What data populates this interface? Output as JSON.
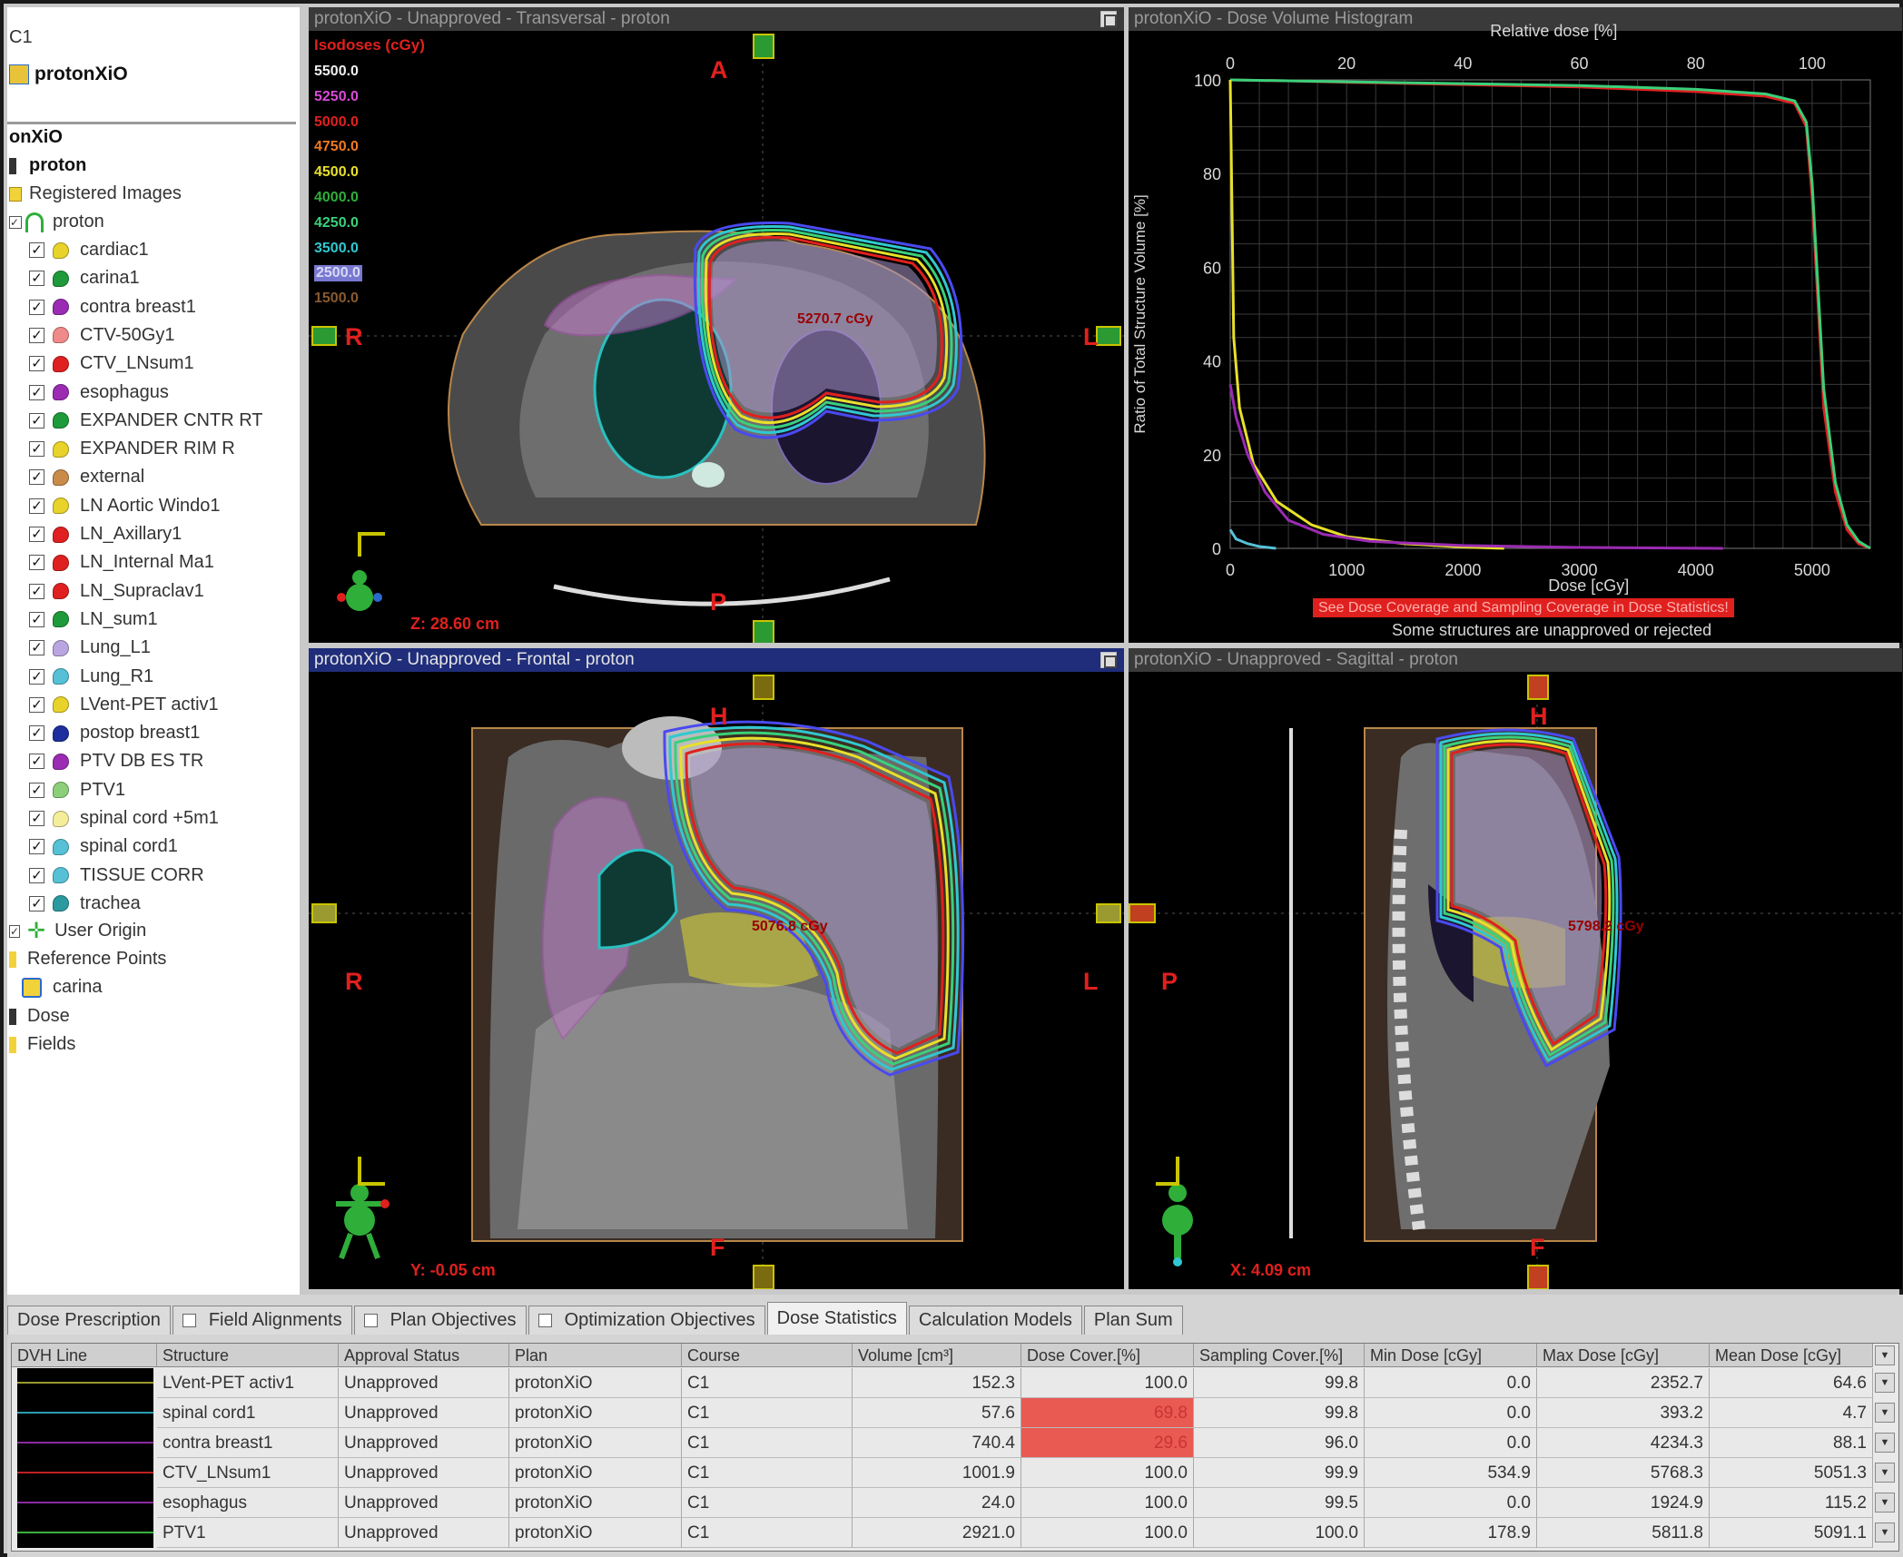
{
  "sidebar": {
    "top_code": "C1",
    "top_item": "protonXiO",
    "header": "onXiO",
    "plan": "proton",
    "registered_images": "Registered Images",
    "image_set": "proton",
    "structures": [
      {
        "name": "cardiac1",
        "color": "#e8d32a"
      },
      {
        "name": "carina1",
        "color": "#1f9a3a"
      },
      {
        "name": "contra breast1",
        "color": "#9b2bb3"
      },
      {
        "name": "CTV-50Gy1",
        "color": "#f08a8a"
      },
      {
        "name": "CTV_LNsum1",
        "color": "#e02020"
      },
      {
        "name": "esophagus",
        "color": "#9b2bb3"
      },
      {
        "name": "EXPANDER CNTR RT",
        "color": "#1f9a3a"
      },
      {
        "name": "EXPANDER RIM R",
        "color": "#e8d32a"
      },
      {
        "name": "external",
        "color": "#c98b4a"
      },
      {
        "name": "LN Aortic Windo1",
        "color": "#e8d32a"
      },
      {
        "name": "LN_Axillary1",
        "color": "#e02020"
      },
      {
        "name": "LN_Internal Ma1",
        "color": "#e02020"
      },
      {
        "name": "LN_Supraclav1",
        "color": "#e02020"
      },
      {
        "name": "LN_sum1",
        "color": "#1f9a3a"
      },
      {
        "name": "Lung_L1",
        "color": "#b9a6e0"
      },
      {
        "name": "Lung_R1",
        "color": "#56c1d6"
      },
      {
        "name": "LVent-PET activ1",
        "color": "#e8d32a"
      },
      {
        "name": "postop breast1",
        "color": "#1d2f9e"
      },
      {
        "name": "PTV DB ES TR",
        "color": "#9b2bb3"
      },
      {
        "name": "PTV1",
        "color": "#8ccf7a"
      },
      {
        "name": "spinal cord +5m1",
        "color": "#f4ed9a"
      },
      {
        "name": "spinal cord1",
        "color": "#56c1d6"
      },
      {
        "name": "TISSUE CORR",
        "color": "#56c1d6"
      },
      {
        "name": "trachea",
        "color": "#2a9aa0"
      }
    ],
    "user_origin": "User Origin",
    "reference_points": "Reference Points",
    "carina": "carina",
    "dose": "Dose",
    "fields": "Fields"
  },
  "views": {
    "transversal": {
      "title": "protonXiO - Unapproved - Transversal - proton",
      "top": "A",
      "bottom": "P",
      "left": "R",
      "right": "L",
      "position": "Z: 28.60 cm",
      "dose_label": "5270.7 cGy"
    },
    "frontal": {
      "title": "protonXiO - Unapproved - Frontal - proton",
      "top": "H",
      "bottom": "F",
      "left": "R",
      "right": "L",
      "position": "Y: -0.05 cm",
      "dose_label": "5076.8 cGy"
    },
    "sagittal": {
      "title": "protonXiO - Unapproved - Sagittal - proton",
      "top": "H",
      "bottom": "F",
      "left": "P",
      "position": "X: 4.09 cm",
      "dose_label": "5798.2 cGy"
    }
  },
  "isodoses": {
    "title": "Isodoses (cGy)",
    "levels": [
      {
        "value": "5500.0",
        "color": "#f0f0f0"
      },
      {
        "value": "5250.0",
        "color": "#d84bd8"
      },
      {
        "value": "5000.0",
        "color": "#e0201e"
      },
      {
        "value": "4750.0",
        "color": "#f07a20"
      },
      {
        "value": "4500.0",
        "color": "#e8e02a"
      },
      {
        "value": "4000.0",
        "color": "#2fae3a"
      },
      {
        "value": "4250.0",
        "color": "#3ad07a"
      },
      {
        "value": "3500.0",
        "color": "#30c8d0"
      },
      {
        "value": "2500.0",
        "color": "#d8d8f8"
      },
      {
        "value": "1500.0",
        "color": "#8a5a30"
      }
    ]
  },
  "dvh": {
    "title": "protonXiO - Dose Volume Histogram",
    "warning": "See Dose Coverage and Sampling Coverage in Dose Statistics!",
    "note": "Some structures are unapproved or rejected"
  },
  "chart_data": {
    "type": "line",
    "title": "",
    "xlabel": "Dose [cGy]",
    "x2label": "Relative dose [%]",
    "ylabel": "Ratio of Total Structure Volume [%]",
    "xlim": [
      0,
      5500
    ],
    "ylim": [
      0,
      100
    ],
    "x_ticks": [
      "1000",
      "2000",
      "3000",
      "4000",
      "5000"
    ],
    "x_tick_zero": "0",
    "x2_ticks": [
      "0",
      "20",
      "40",
      "60",
      "80",
      "100"
    ],
    "y_ticks": [
      "0",
      "20",
      "40",
      "60",
      "80",
      "100"
    ],
    "grid": true,
    "series": [
      {
        "color": "#e02020",
        "x": [
          0,
          500,
          1000,
          2000,
          3000,
          4000,
          4600,
          4850,
          4950,
          5000,
          5100,
          5200,
          5300,
          5400,
          5500
        ],
        "y": [
          100,
          99.8,
          99.5,
          99,
          98.5,
          97.5,
          96.5,
          95,
          90,
          75,
          30,
          12,
          4,
          1,
          0
        ]
      },
      {
        "color": "#3ad07a",
        "x": [
          0,
          500,
          1000,
          2000,
          3000,
          4000,
          4600,
          4850,
          4950,
          5000,
          5100,
          5200,
          5300,
          5400,
          5500
        ],
        "y": [
          100,
          99.8,
          99.6,
          99.2,
          98.8,
          98,
          97,
          95.5,
          91,
          78,
          34,
          14,
          5,
          1.5,
          0
        ]
      },
      {
        "color": "#e8e02a",
        "x": [
          0,
          30,
          80,
          200,
          400,
          700,
          1000,
          1500,
          2000,
          2353
        ],
        "y": [
          100,
          45,
          30,
          18,
          10,
          5,
          2.5,
          1,
          0.3,
          0
        ]
      },
      {
        "color": "#9b2bb3",
        "x": [
          0,
          50,
          150,
          300,
          500,
          800,
          1200,
          2000,
          3000,
          4234
        ],
        "y": [
          35,
          28,
          20,
          12,
          6,
          3,
          1.5,
          0.6,
          0.2,
          0
        ]
      },
      {
        "color": "#56c1d6",
        "x": [
          0,
          50,
          150,
          250,
          393
        ],
        "y": [
          4,
          2,
          1,
          0.4,
          0
        ]
      }
    ]
  },
  "bottom": {
    "tabs": [
      {
        "label": "Dose Prescription",
        "checkbox": false,
        "active": false
      },
      {
        "label": "Field Alignments",
        "checkbox": true,
        "active": false
      },
      {
        "label": "Plan Objectives",
        "checkbox": true,
        "active": false
      },
      {
        "label": "Optimization Objectives",
        "checkbox": true,
        "active": false
      },
      {
        "label": "Dose Statistics",
        "checkbox": false,
        "active": true
      },
      {
        "label": "Calculation Models",
        "checkbox": false,
        "active": false
      },
      {
        "label": "Plan Sum",
        "checkbox": false,
        "active": false
      }
    ],
    "columns": [
      "DVH Line",
      "Structure",
      "Approval Status",
      "Plan",
      "Course",
      "Volume [cm³]",
      "Dose Cover.[%]",
      "Sampling Cover.[%]",
      "Min Dose [cGy]",
      "Max Dose [cGy]",
      "Mean Dose [cGy]"
    ],
    "rows": [
      {
        "color": "#9a9a30",
        "structure": "LVent-PET activ1",
        "status": "Unapproved",
        "plan": "protonXiO",
        "course": "C1",
        "volume": "152.3",
        "dose_cover": "100.0",
        "sampling": "99.8",
        "min": "0.0",
        "max": "2352.7",
        "mean": "64.6",
        "hl": false
      },
      {
        "color": "#2aa0b0",
        "structure": "spinal cord1",
        "status": "Unapproved",
        "plan": "protonXiO",
        "course": "C1",
        "volume": "57.6",
        "dose_cover": "69.8",
        "sampling": "99.8",
        "min": "0.0",
        "max": "393.2",
        "mean": "4.7",
        "hl": true
      },
      {
        "color": "#8a2ba0",
        "structure": "contra breast1",
        "status": "Unapproved",
        "plan": "protonXiO",
        "course": "C1",
        "volume": "740.4",
        "dose_cover": "29.6",
        "sampling": "96.0",
        "min": "0.0",
        "max": "4234.3",
        "mean": "88.1",
        "hl": true
      },
      {
        "color": "#c02020",
        "structure": "CTV_LNsum1",
        "status": "Unapproved",
        "plan": "protonXiO",
        "course": "C1",
        "volume": "1001.9",
        "dose_cover": "100.0",
        "sampling": "99.9",
        "min": "534.9",
        "max": "5768.3",
        "mean": "5051.3",
        "hl": false
      },
      {
        "color": "#8a2ba0",
        "structure": "esophagus",
        "status": "Unapproved",
        "plan": "protonXiO",
        "course": "C1",
        "volume": "24.0",
        "dose_cover": "100.0",
        "sampling": "99.5",
        "min": "0.0",
        "max": "1924.9",
        "mean": "115.2",
        "hl": false
      },
      {
        "color": "#3ab040",
        "structure": "PTV1",
        "status": "Unapproved",
        "plan": "protonXiO",
        "course": "C1",
        "volume": "2921.0",
        "dose_cover": "100.0",
        "sampling": "100.0",
        "min": "178.9",
        "max": "5811.8",
        "mean": "5091.1",
        "hl": false
      }
    ]
  }
}
